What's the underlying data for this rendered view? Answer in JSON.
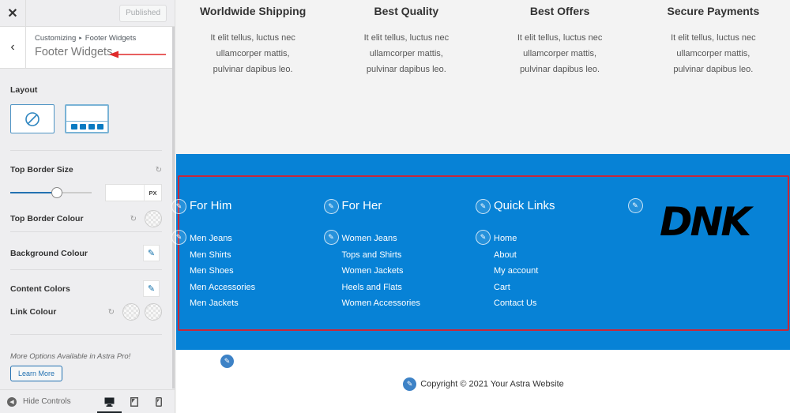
{
  "sidebar": {
    "published_label": "Published",
    "breadcrumb_root": "Customizing",
    "breadcrumb_current": "Footer Widgets",
    "panel_title": "Footer Widgets",
    "layout_label": "Layout",
    "top_border_size_label": "Top Border Size",
    "top_border_size_value": "",
    "top_border_size_unit": "PX",
    "top_border_size_slider_fraction": 0.58,
    "top_border_colour_label": "Top Border Colour",
    "background_colour_label": "Background Colour",
    "content_colors_label": "Content Colors",
    "link_colour_label": "Link Colour",
    "pro_note": "More Options Available in Astra Pro!",
    "learn_more_label": "Learn More",
    "hide_controls_label": "Hide Controls"
  },
  "preview": {
    "features": [
      {
        "title": "Worldwide Shipping",
        "text": "It elit tellus, luctus nec ullamcorper mattis, pulvinar dapibus leo."
      },
      {
        "title": "Best Quality",
        "text": "It elit tellus, luctus nec ullamcorper mattis, pulvinar dapibus leo."
      },
      {
        "title": "Best Offers",
        "text": "It elit tellus, luctus nec ullamcorper mattis, pulvinar dapibus leo."
      },
      {
        "title": "Secure Payments",
        "text": "It elit tellus, luctus nec ullamcorper mattis, pulvinar dapibus leo."
      }
    ],
    "widgets": [
      {
        "title": "For Him",
        "links": [
          "Men Jeans",
          "Men Shirts",
          "Men Shoes",
          "Men Accessories",
          "Men Jackets"
        ]
      },
      {
        "title": "For Her",
        "links": [
          "Women Jeans",
          "Tops and Shirts",
          "Women Jackets",
          "Heels and Flats",
          "Women Accessories"
        ]
      },
      {
        "title": "Quick Links",
        "links": [
          "Home",
          "About",
          "My account",
          "Cart",
          "Contact Us"
        ]
      }
    ],
    "logo_text": "DNK",
    "copyright": "Copyright © 2021 Your Astra Website"
  },
  "colors": {
    "footer_bg": "#0782d6",
    "highlight_border": "#c8283a",
    "accent": "#2271b1"
  }
}
